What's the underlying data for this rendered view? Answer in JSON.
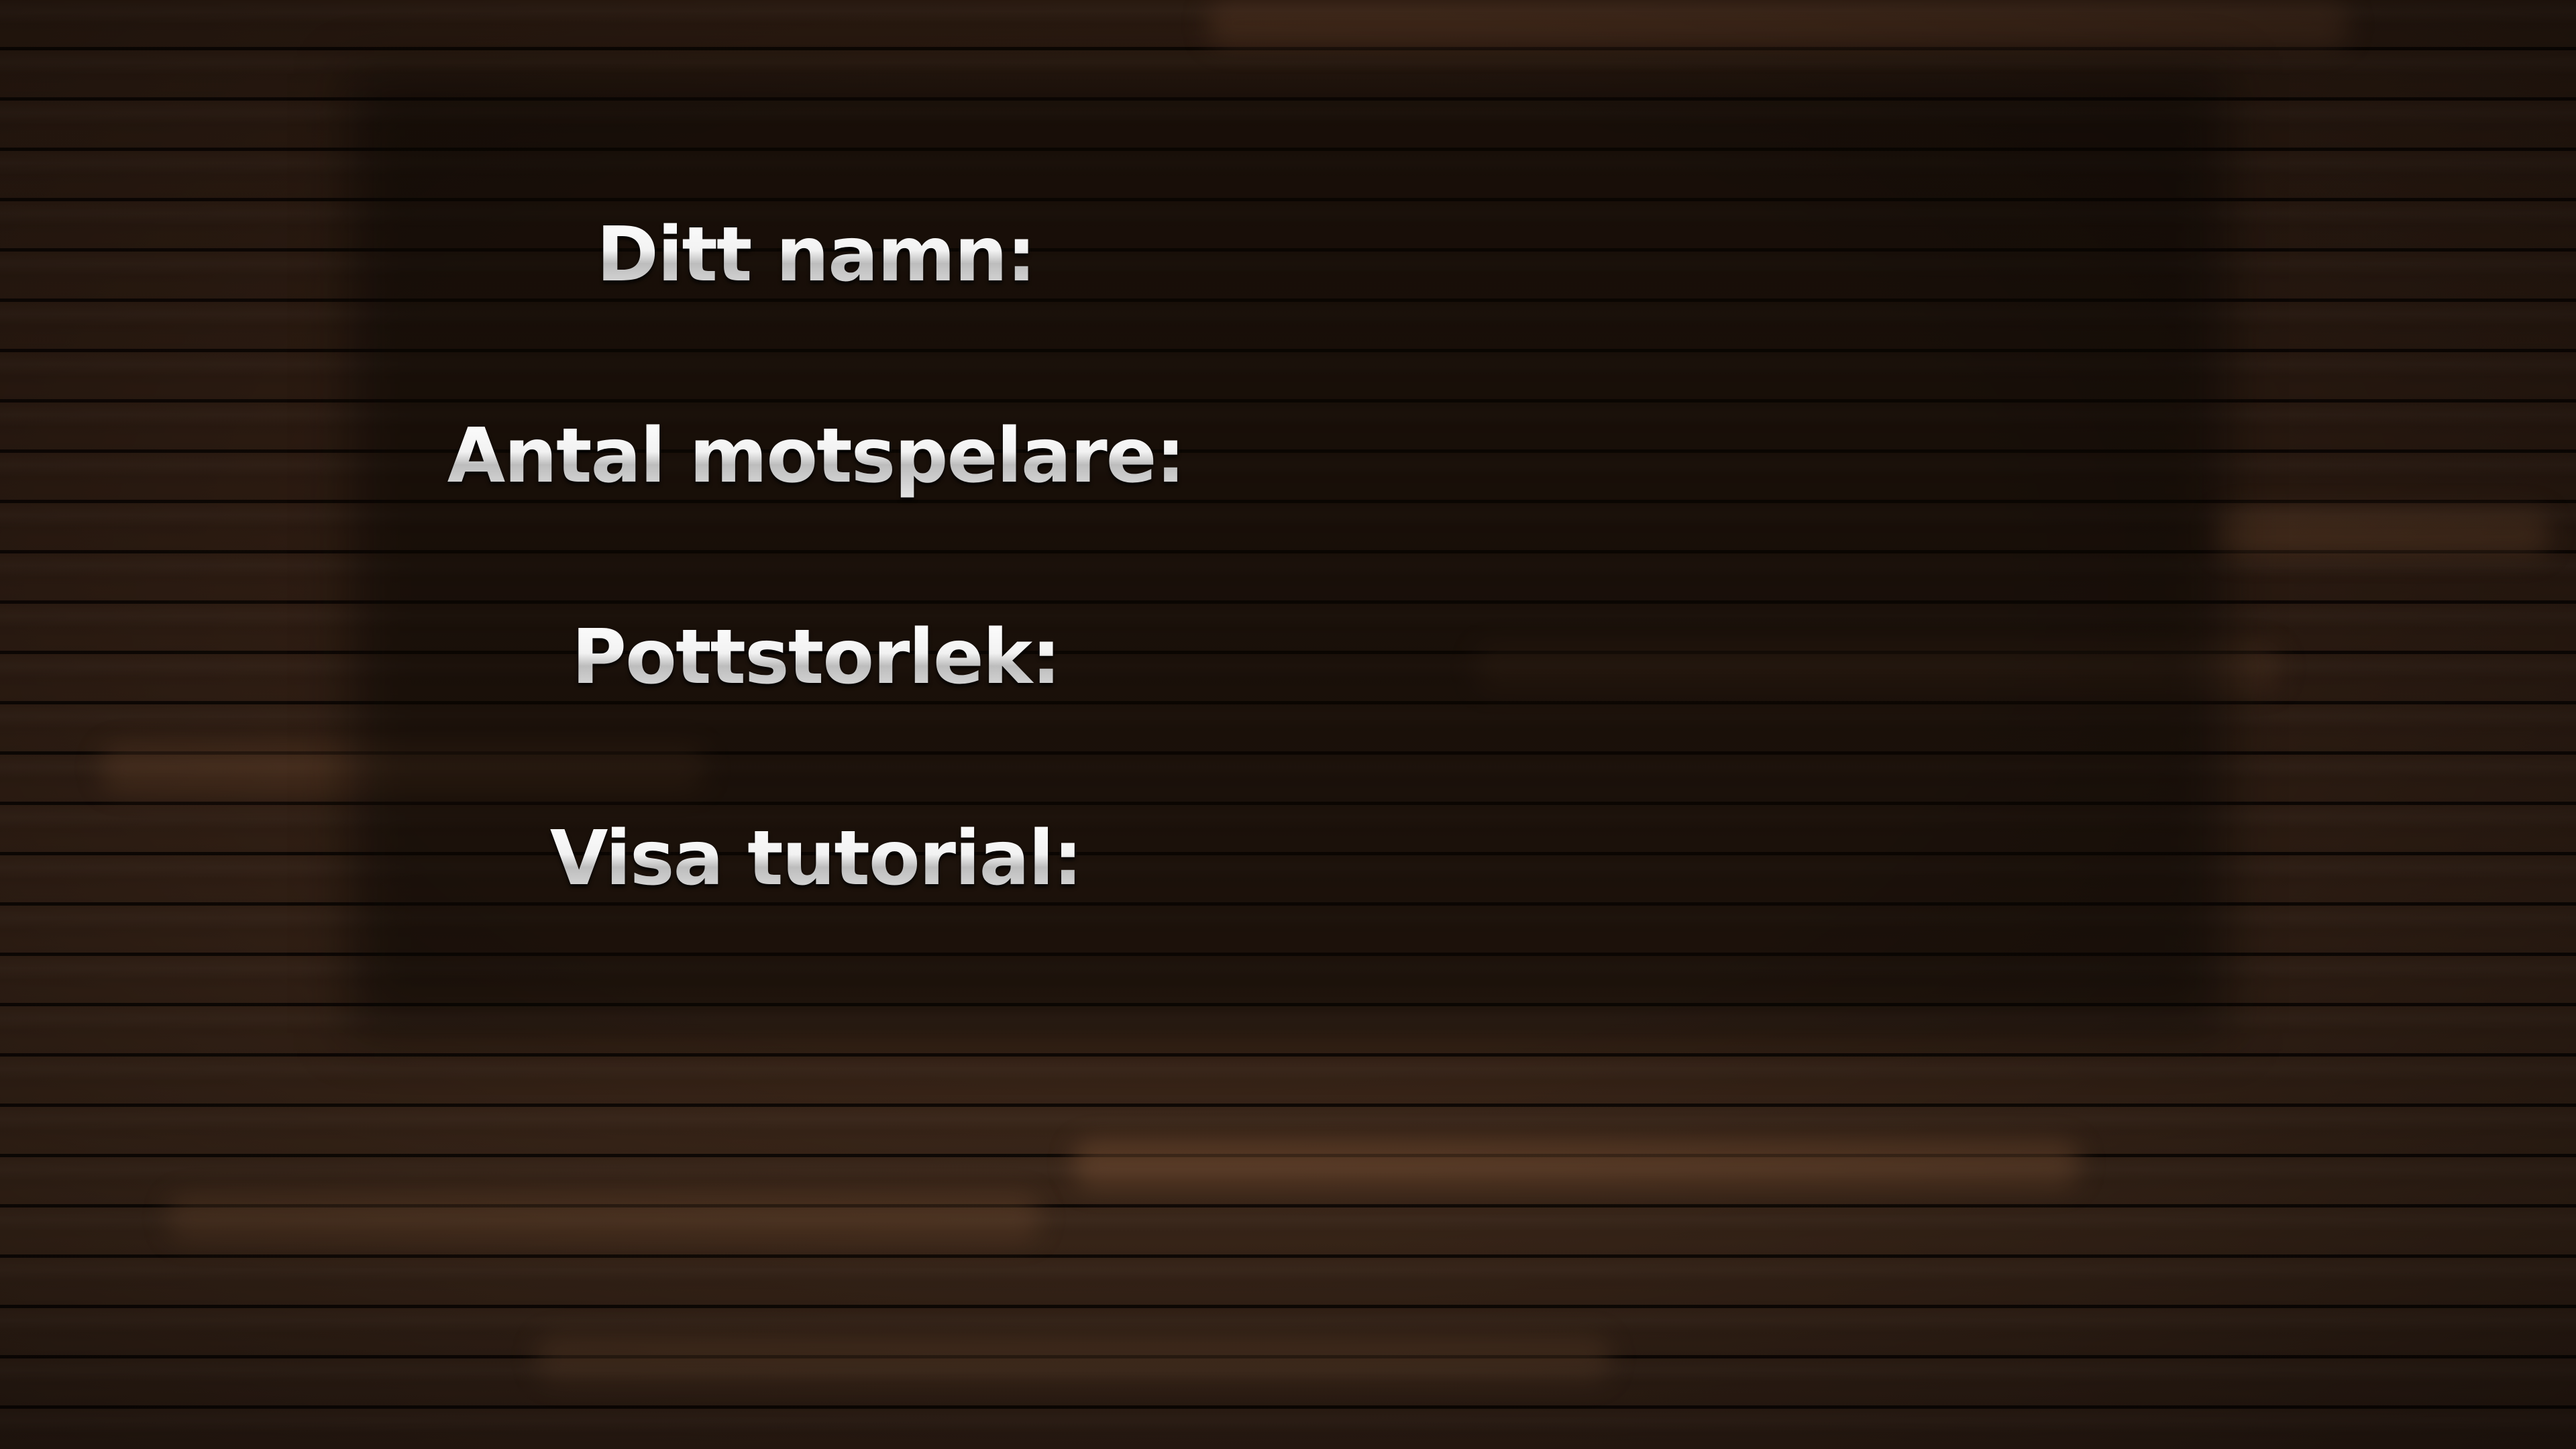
{
  "settings": {
    "player_name_label": "Ditt namn:",
    "opponents_label": "Antal motspelare:",
    "pot_size_label": "Pottstorlek:",
    "show_tutorial_label": "Visa tutorial:"
  },
  "colors": {
    "background_wood": "#2c1b11",
    "plank_seam": "#080402",
    "label_text": "#e9e9e9"
  }
}
